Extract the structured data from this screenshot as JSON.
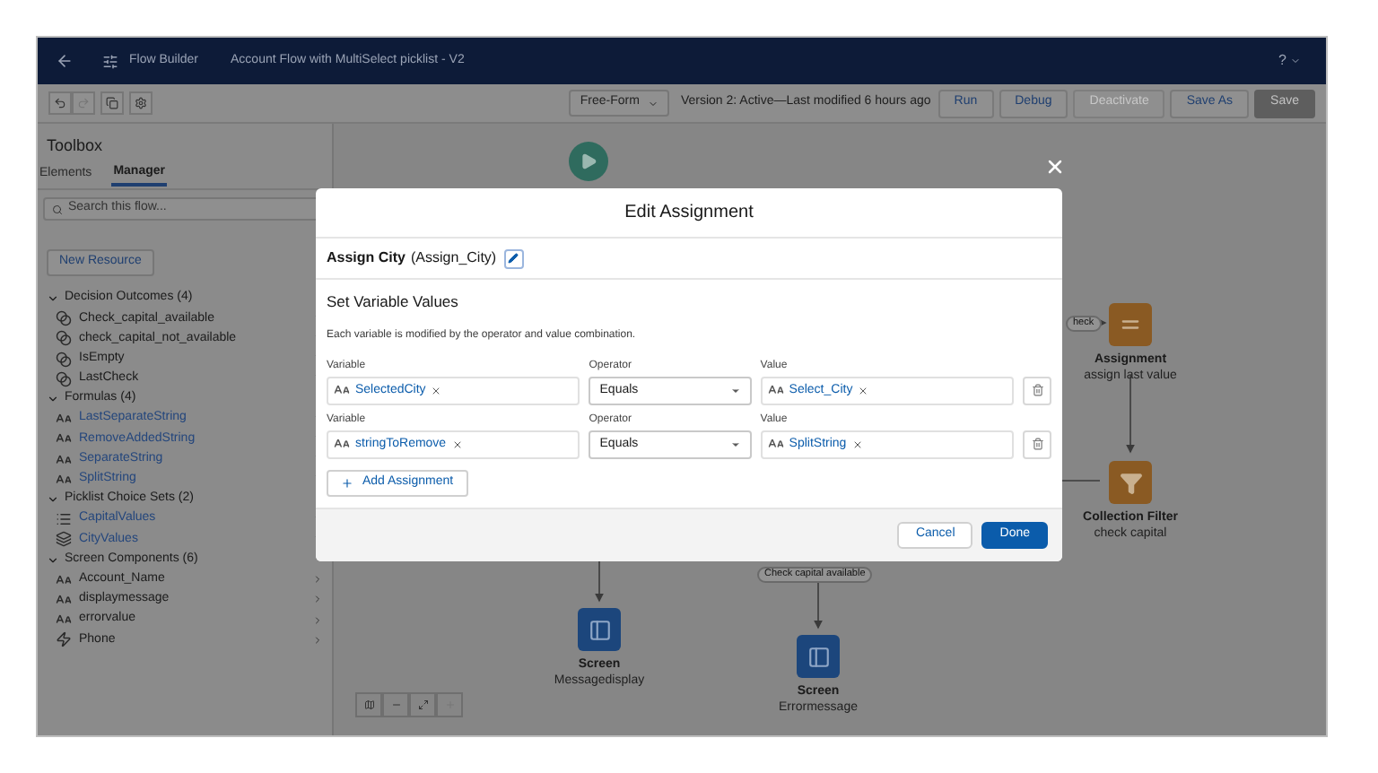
{
  "header": {
    "app": "Flow Builder",
    "flow_name": "Account Flow with MultiSelect picklist - V2",
    "help": "?"
  },
  "toolbar": {
    "layout": "Free-Form",
    "version": "Version 2: Active—Last modified 6 hours ago",
    "buttons": [
      {
        "label": "Run",
        "disabled": false
      },
      {
        "label": "Debug",
        "disabled": false
      },
      {
        "label": "Deactivate",
        "disabled": true
      },
      {
        "label": "Save As",
        "disabled": false
      },
      {
        "label": "Save",
        "disabled": true
      }
    ]
  },
  "toolbox": {
    "title": "Toolbox",
    "tabs": [
      {
        "label": "Elements",
        "selected": false
      },
      {
        "label": "Manager",
        "selected": true
      }
    ],
    "search": {
      "placeholder": "Search this flow..."
    },
    "new_resource": "New Resource",
    "sections": [
      {
        "title": "Decision Outcomes (4)",
        "expanded": true,
        "items": [
          {
            "label": "Check_capital_available",
            "kind": "outcome",
            "link": false
          },
          {
            "label": "check_capital_not_available",
            "kind": "outcome",
            "link": false
          },
          {
            "label": "IsEmpty",
            "kind": "outcome",
            "link": false
          },
          {
            "label": "LastCheck",
            "kind": "outcome",
            "link": false
          }
        ]
      },
      {
        "title": "Formulas (4)",
        "expanded": true,
        "items": [
          {
            "label": "LastSeparateString",
            "kind": "text",
            "link": true
          },
          {
            "label": "RemoveAddedString",
            "kind": "text",
            "link": true
          },
          {
            "label": "SeparateString",
            "kind": "text",
            "link": true
          },
          {
            "label": "SplitString",
            "kind": "text",
            "link": true
          }
        ]
      },
      {
        "title": "Picklist Choice Sets (2)",
        "expanded": true,
        "items": [
          {
            "label": "CapitalValues",
            "kind": "list",
            "link": true
          },
          {
            "label": "CityValues",
            "kind": "collection",
            "link": true
          }
        ]
      },
      {
        "title": "Screen Components (6)",
        "expanded": true,
        "items": [
          {
            "label": "Account_Name",
            "kind": "text",
            "link": false
          },
          {
            "label": "displaymessage",
            "kind": "text",
            "link": false
          },
          {
            "label": "errorvalue",
            "kind": "text",
            "link": false
          },
          {
            "label": "Phone",
            "kind": "phone",
            "link": false
          }
        ]
      }
    ]
  },
  "canvas": {
    "nodes": [
      {
        "kind": "start"
      },
      {
        "kind": "assignment",
        "title": "Assignment",
        "subtitle": "assign last value"
      },
      {
        "kind": "filter",
        "title": "Collection Filter",
        "subtitle": "check capital"
      },
      {
        "kind": "screen",
        "title": "Screen",
        "subtitle": "Messagedisplay"
      },
      {
        "kind": "screen",
        "title": "Screen",
        "subtitle": "Errormessage"
      }
    ],
    "connector_labels": [
      {
        "label": "heck"
      },
      {
        "label": "Check capital available"
      }
    ]
  },
  "modal": {
    "title": "Edit Assignment",
    "element_label": "Assign City",
    "api_name": "(Assign_City)",
    "section": "Set Variable Values",
    "description": "Each variable is modified by the operator and value combination.",
    "rows": [
      {
        "variable_label": "Variable",
        "variable": "SelectedCity",
        "operator_label": "Operator",
        "operator": "Equals",
        "value_label": "Value",
        "value": "Select_City"
      },
      {
        "variable_label": "Variable",
        "variable": "stringToRemove",
        "operator_label": "Operator",
        "operator": "Equals",
        "value_label": "Value",
        "value": "SplitString"
      }
    ],
    "add_button": "Add Assignment",
    "buttons": [
      {
        "label": "Cancel",
        "kind": "secondary"
      },
      {
        "label": "Done",
        "kind": "primary"
      }
    ]
  }
}
